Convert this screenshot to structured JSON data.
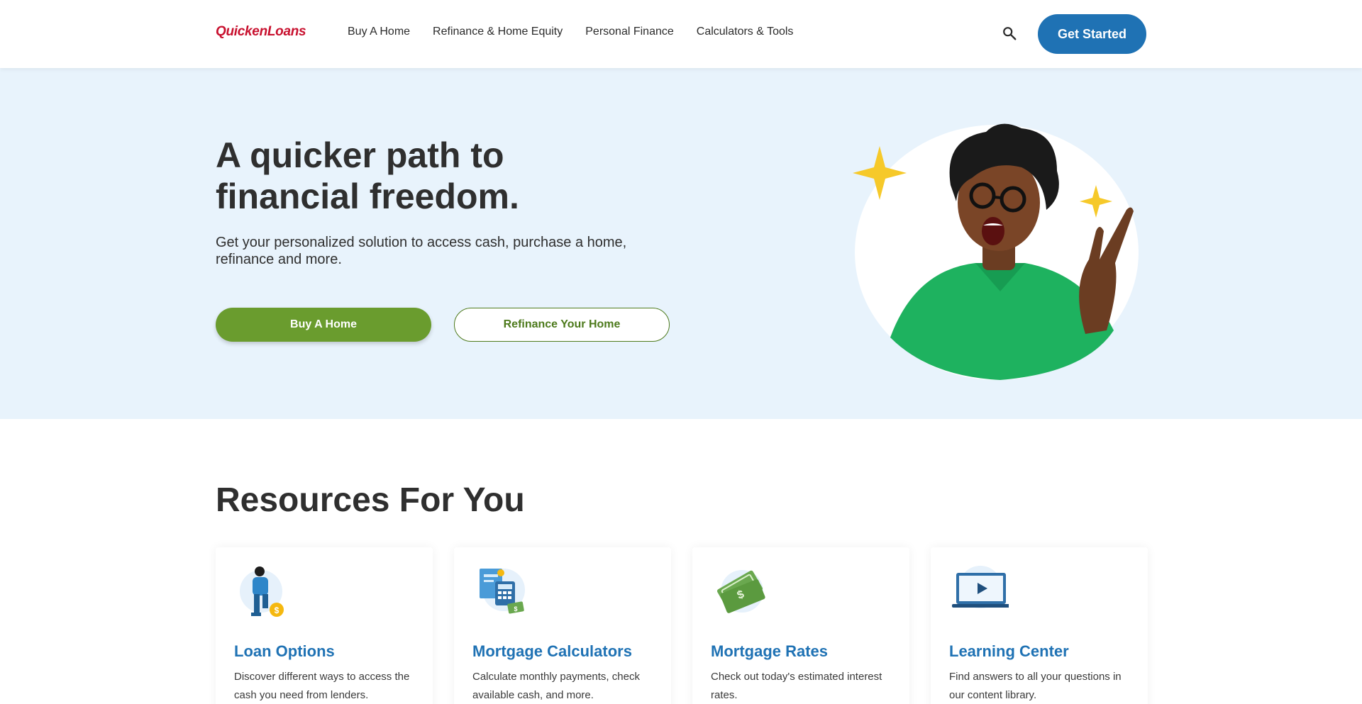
{
  "header": {
    "logo_text": "QuickenLoans",
    "nav": [
      {
        "label": "Buy A Home"
      },
      {
        "label": "Refinance & Home Equity"
      },
      {
        "label": "Personal Finance"
      },
      {
        "label": "Calculators & Tools"
      }
    ],
    "search_icon": "search-icon",
    "cta_label": "Get Started"
  },
  "hero": {
    "title": "A quicker path to financial freedom.",
    "subtitle": "Get your personalized solution to access cash, purchase a home, refinance and more.",
    "primary_button": "Buy A Home",
    "secondary_button": "Refinance Your Home"
  },
  "resources": {
    "title": "Resources For You",
    "cards": [
      {
        "title": "Loan Options",
        "description": "Discover different ways to access the cash you need from lenders.",
        "icon": "person-coin-icon"
      },
      {
        "title": "Mortgage Calculators",
        "description": "Calculate monthly payments, check available cash, and more.",
        "icon": "calculator-icon"
      },
      {
        "title": "Mortgage Rates",
        "description": "Check out today's estimated interest rates.",
        "icon": "money-icon"
      },
      {
        "title": "Learning Center",
        "description": "Find answers to all your questions in our content library.",
        "icon": "laptop-play-icon"
      }
    ]
  },
  "colors": {
    "brand_red": "#c8102e",
    "primary_blue": "#1f72b4",
    "primary_green": "#6a9c2e",
    "hero_bg": "#e8f3fc"
  }
}
